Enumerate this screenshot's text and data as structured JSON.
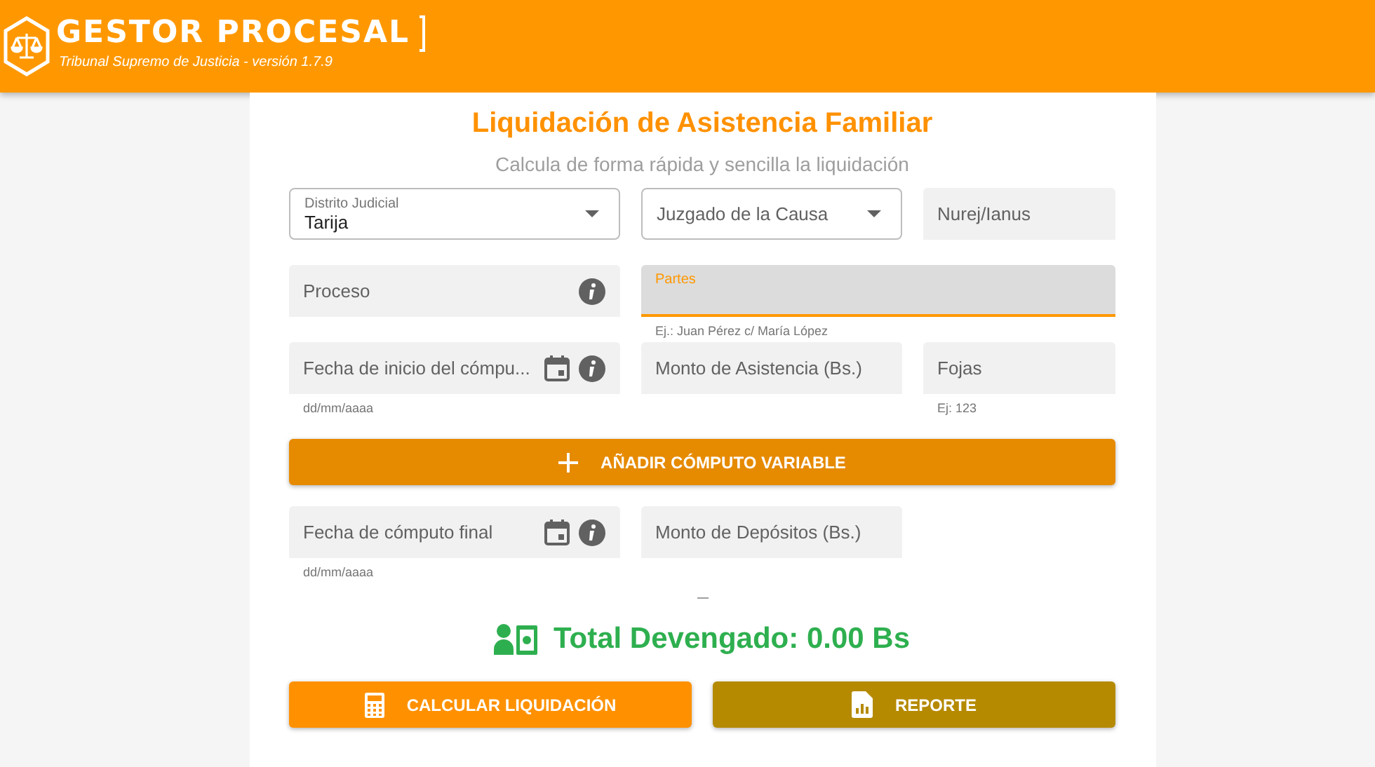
{
  "header": {
    "title": "GESTOR PROCESAL",
    "subtitle": "Tribunal Supremo de Justicia - versión 1.7.9"
  },
  "form": {
    "title": "Liquidación de Asistencia Familiar",
    "subtitle": "Calcula de forma rápida y sencilla la liquidación",
    "rows": [
      {
        "fields": [
          {
            "kind": "select",
            "label": "Distrito Judicial",
            "value": "Tarija"
          },
          {
            "kind": "select",
            "label": "Juzgado de la Causa"
          },
          {
            "kind": "filled",
            "label": "Nurej/Ianus"
          }
        ]
      },
      {
        "fields": [
          {
            "kind": "filled",
            "label": "Proceso",
            "info": true
          },
          {
            "kind": "focused",
            "label": "Partes",
            "hint": "Ej.: Juan Pérez c/ María López"
          }
        ]
      },
      {
        "fields": [
          {
            "kind": "filled",
            "label": "Fecha de inicio del cómpu...",
            "calendar": true,
            "info": true,
            "hint": "dd/mm/aaaa"
          },
          {
            "kind": "filled",
            "label": "Monto de Asistencia (Bs.)"
          },
          {
            "kind": "filled",
            "label": "Fojas",
            "hint": "Ej: 123"
          }
        ]
      },
      {
        "button": {
          "label": "AÑADIR CÓMPUTO VARIABLE",
          "kind": "add"
        }
      },
      {
        "fields": [
          {
            "kind": "filled",
            "label": "Fecha de cómputo final",
            "calendar": true,
            "info": true,
            "hint": "dd/mm/aaaa"
          },
          {
            "kind": "filled",
            "label": "Monto de Depósitos (Bs.)"
          }
        ]
      }
    ],
    "total": "Total Devengado: 0.00 Bs",
    "actions": [
      {
        "label": "CALCULAR LIQUIDACIÓN",
        "kind": "calculate"
      },
      {
        "label": "REPORTE",
        "kind": "report"
      }
    ]
  }
}
